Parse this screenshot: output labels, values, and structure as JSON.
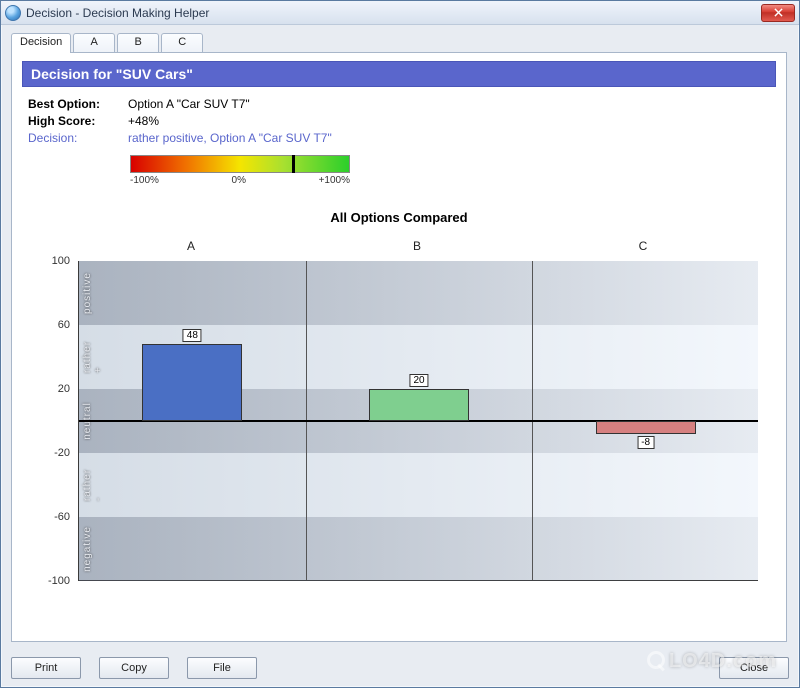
{
  "window": {
    "title": "Decision - Decision Making Helper"
  },
  "tabs": [
    {
      "label": "Decision"
    },
    {
      "label": "A"
    },
    {
      "label": "B"
    },
    {
      "label": "C"
    }
  ],
  "header": {
    "title": "Decision for  \"SUV Cars\""
  },
  "summary": {
    "best_label": "Best Option:",
    "best_value": "Option A \"Car SUV T7\"",
    "high_label": "High Score:",
    "high_value": "+48%",
    "decision_label": "Decision:",
    "decision_value": "rather positive, Option A \"Car SUV T7\""
  },
  "gradient": {
    "min_label": "-100%",
    "mid_label": "0%",
    "max_label": "+100%",
    "marker_percent": 74
  },
  "chart_data": {
    "type": "bar",
    "title": "All Options Compared",
    "categories": [
      "A",
      "B",
      "C"
    ],
    "values": [
      48,
      20,
      -8
    ],
    "ylim": [
      -100,
      100
    ],
    "y_ticks": [
      100,
      60,
      20,
      -20,
      -60,
      -100
    ],
    "zones": [
      {
        "name": "positive",
        "from": 60,
        "to": 100,
        "shaded": true
      },
      {
        "name": "rather +",
        "from": 20,
        "to": 60,
        "shaded": false
      },
      {
        "name": "neutral",
        "from": -20,
        "to": 20,
        "shaded": true
      },
      {
        "name": "rather -",
        "from": -60,
        "to": -20,
        "shaded": false
      },
      {
        "name": "negative",
        "from": -100,
        "to": -60,
        "shaded": true
      }
    ],
    "bar_colors": [
      "#4a6fc4",
      "#7fcf8f",
      "#d68080"
    ]
  },
  "buttons": {
    "print": "Print",
    "copy": "Copy",
    "file": "File",
    "close": "Close"
  },
  "watermark": "LO4D.com"
}
